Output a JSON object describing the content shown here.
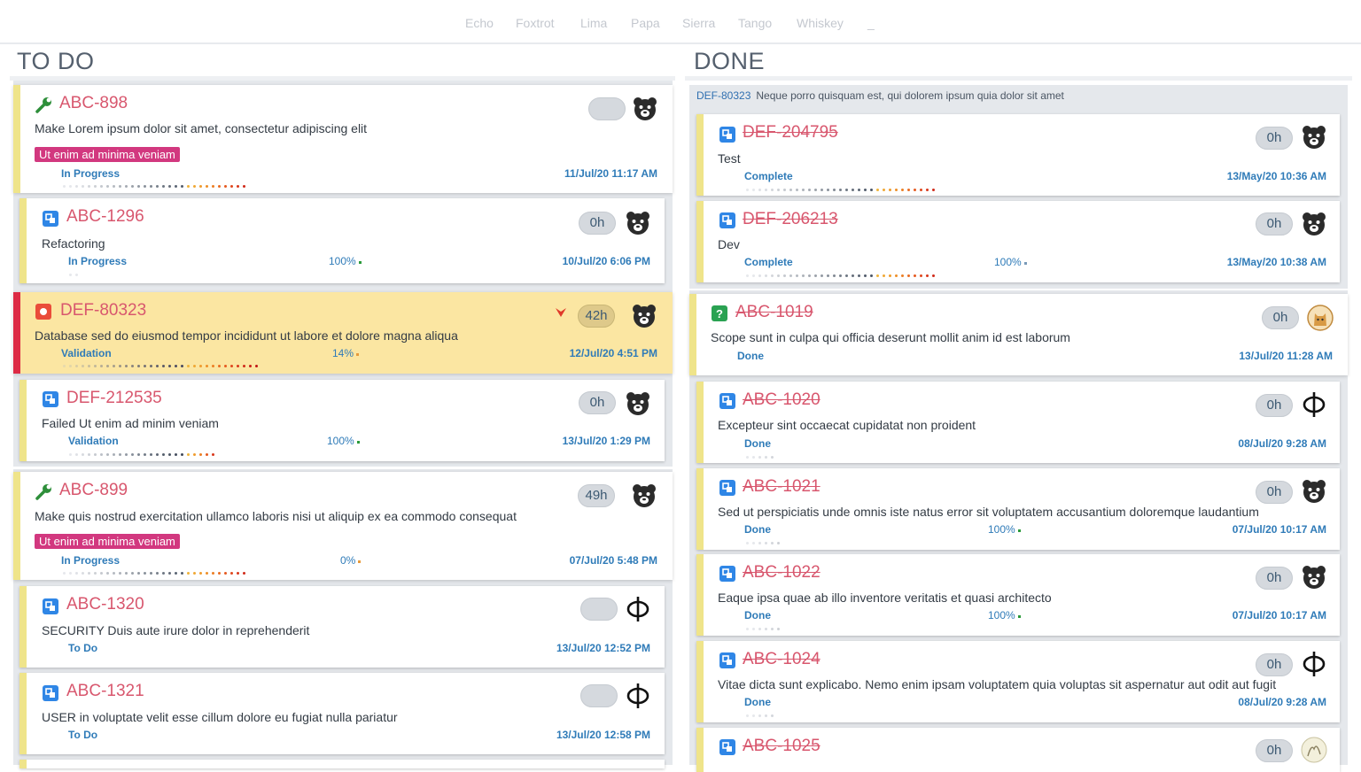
{
  "nav": {
    "tabs": [
      "Echo",
      "Foxtrot",
      "Lima",
      "Papa",
      "Sierra",
      "Tango",
      "Whiskey",
      "_"
    ]
  },
  "columns": {
    "todo_title": "TO DO",
    "done_title": "DONE"
  },
  "todo": [
    {
      "id": "ABC-898",
      "title": "Make Lorem ipsum dolor sit amet, consectetur adipiscing elit",
      "label": "Ut enim ad minima veniam",
      "status": "In Progress",
      "date": "11/Jul/20 11:17 AM",
      "estimate": "",
      "icon": "wrench-icon",
      "avatar": "bear-avatar"
    },
    {
      "id": "ABC-1296",
      "title": "Refactoring",
      "status": "In Progress",
      "progress": "100%",
      "date": "10/Jul/20 6:06 PM",
      "estimate": "0h",
      "icon": "subtask-icon",
      "avatar": "bear-avatar"
    },
    {
      "id": "DEF-80323",
      "title": "Database sed do eiusmod tempor incididunt ut labore et dolore magna aliqua",
      "status": "Validation",
      "progress": "14%",
      "date": "12/Jul/20 4:51 PM",
      "estimate": "42h",
      "icon": "bug-icon",
      "avatar": "bear-avatar",
      "highlighted": true
    },
    {
      "id": "DEF-212535",
      "title": "Failed Ut enim ad minim veniam",
      "status": "Validation",
      "progress": "100%",
      "date": "13/Jul/20 1:29 PM",
      "estimate": "0h",
      "icon": "subtask-icon",
      "avatar": "bear-avatar"
    },
    {
      "id": "ABC-899",
      "title": "Make quis nostrud exercitation ullamco laboris nisi ut aliquip ex ea commodo consequat",
      "label": "Ut enim ad minima veniam",
      "status": "In Progress",
      "progress": "0%",
      "date": "07/Jul/20 5:48 PM",
      "estimate": "49h",
      "icon": "wrench-icon",
      "avatar": "bear-avatar"
    },
    {
      "id": "ABC-1320",
      "title": "SECURITY Duis aute irure dolor in reprehenderit",
      "status": "To Do",
      "date": "13/Jul/20 12:52 PM",
      "estimate": "",
      "icon": "subtask-icon",
      "avatar": "phi-avatar"
    },
    {
      "id": "ABC-1321",
      "title": "USER in voluptate velit esse cillum dolore eu fugiat nulla pariatur",
      "status": "To Do",
      "date": "13/Jul/20 12:58 PM",
      "estimate": "",
      "icon": "subtask-icon",
      "avatar": "phi-avatar"
    }
  ],
  "done_group": {
    "key": "DEF-80323",
    "summary": "Neque porro quisquam est, qui dolorem ipsum quia dolor sit amet",
    "items": [
      {
        "id": "DEF-204795",
        "title": "Test",
        "status": "Complete",
        "date": "13/May/20 10:36 AM",
        "estimate": "0h"
      },
      {
        "id": "DEF-206213",
        "title": "Dev",
        "status": "Complete",
        "progress": "100%",
        "date": "13/May/20 10:38 AM",
        "estimate": "0h"
      }
    ]
  },
  "done": [
    {
      "id": "ABC-1019",
      "title": "Scope sunt in culpa qui officia deserunt mollit anim id est laborum",
      "status": "Done",
      "date": "13/Jul/20 11:28 AM",
      "estimate": "0h",
      "icon": "question-icon",
      "avatar": "cat-avatar"
    },
    {
      "id": "ABC-1020",
      "title": "Excepteur sint occaecat cupidatat non proident",
      "status": "Done",
      "date": "08/Jul/20 9:28 AM",
      "estimate": "0h",
      "icon": "subtask-icon",
      "avatar": "phi-avatar"
    },
    {
      "id": "ABC-1021",
      "title": "Sed ut perspiciatis unde omnis iste natus error sit voluptatem accusantium doloremque laudantium",
      "status": "Done",
      "progress": "100%",
      "date": "07/Jul/20 10:17 AM",
      "estimate": "0h",
      "icon": "subtask-icon",
      "avatar": "bear-avatar"
    },
    {
      "id": "ABC-1022",
      "title": "Eaque ipsa quae ab illo inventore veritatis et quasi architecto",
      "status": "Done",
      "progress": "100%",
      "date": "07/Jul/20 10:17 AM",
      "estimate": "0h",
      "icon": "subtask-icon",
      "avatar": "bear-avatar"
    },
    {
      "id": "ABC-1024",
      "title": "Vitae dicta sunt explicabo. Nemo enim ipsam voluptatem quia voluptas sit aspernatur aut odit aut fugit",
      "status": "Done",
      "date": "08/Jul/20 9:28 AM",
      "estimate": "0h",
      "icon": "subtask-icon",
      "avatar": "phi-avatar"
    },
    {
      "id": "ABC-1025",
      "estimate": "0h",
      "icon": "subtask-icon",
      "avatar": "sketch-avatar"
    }
  ],
  "colors": {
    "accent_pink": "#d8576e",
    "status_blue": "#2f7bb8",
    "label_magenta": "#d2387f",
    "priority_red": "#dd2b45",
    "card_bar": "#efe48a"
  }
}
